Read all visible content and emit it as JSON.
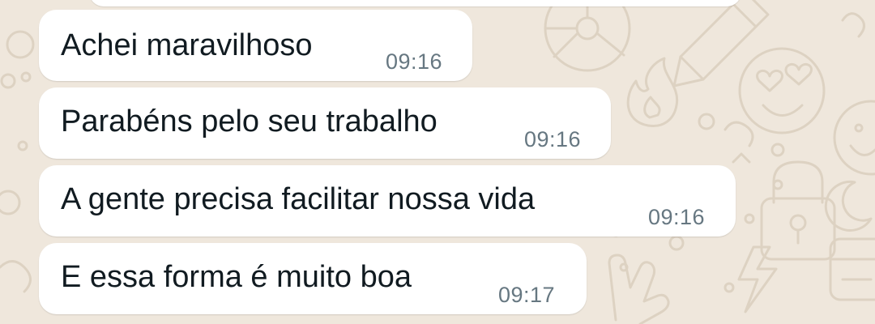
{
  "chat": {
    "messages": [
      {
        "text": "Achei maravilhoso",
        "time": "09:16"
      },
      {
        "text": "Parabéns pelo seu trabalho",
        "time": "09:16"
      },
      {
        "text": "A gente precisa facilitar nossa vida",
        "time": "09:16"
      },
      {
        "text": "E essa forma é muito boa",
        "time": "09:17"
      }
    ]
  },
  "colors": {
    "background": "#efe7dc",
    "bubble": "#ffffff",
    "message_text": "#111b21",
    "timestamp": "#667781"
  },
  "wallpaper_icons": [
    "steering-wheel-icon",
    "pencil-icon",
    "fire-icon",
    "heart-eyes-icon",
    "smiley-icon",
    "padlock-icon",
    "crescent-moon-icon",
    "lightning-icon",
    "rock-hand-icon",
    "calendar-icon",
    "circle-doodle-icon"
  ]
}
